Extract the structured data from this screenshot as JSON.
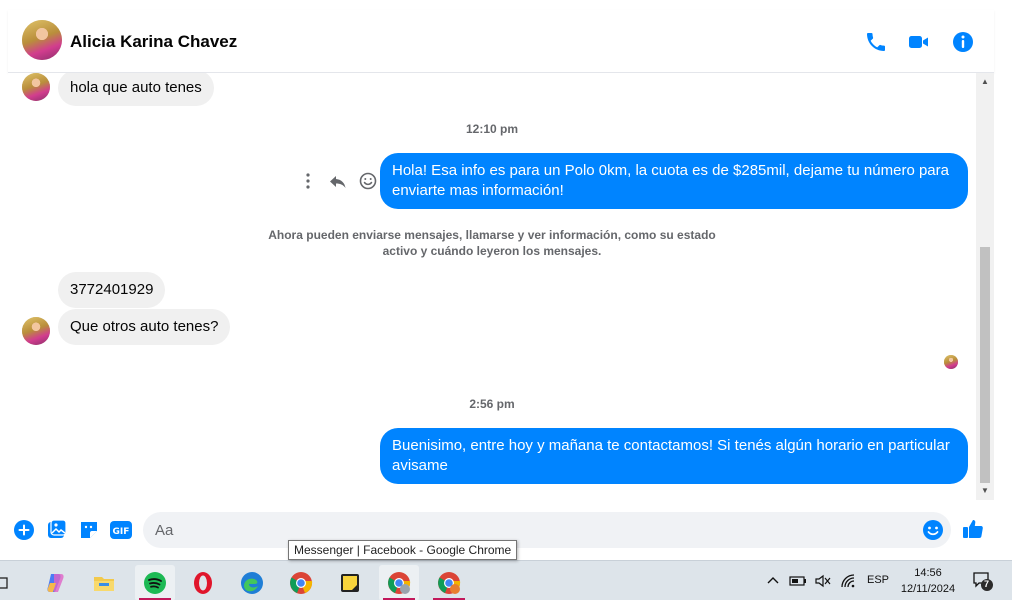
{
  "header": {
    "contact_name": "Alicia Karina Chavez"
  },
  "messages": {
    "in_1": "hola que auto tenes",
    "time_1": "12:10 pm",
    "out_1": "Hola! Esa info es para un Polo 0km, la cuota es de $285mil, dejame tu número para enviarte mas información!",
    "system": "Ahora pueden enviarse mensajes, llamarse y ver información, como su estado activo y cuándo leyeron los mensajes.",
    "in_2": "3772401929",
    "in_3": "Que otros auto tenes?",
    "time_2": "2:56 pm",
    "out_2": "Buenisimo, entre hoy y mañana te contactamos! Si tenés algún horario en particular avisame"
  },
  "composer": {
    "placeholder": "Aa"
  },
  "tooltip": "Messenger | Facebook - Google Chrome",
  "taskbar": {
    "lang": "ESP",
    "time": "14:56",
    "date": "12/11/2024",
    "notif_count": "7"
  },
  "colors": {
    "accent": "#0084ff",
    "incoming_bubble": "#f0f0f0",
    "taskbar": "#dde4ea"
  }
}
